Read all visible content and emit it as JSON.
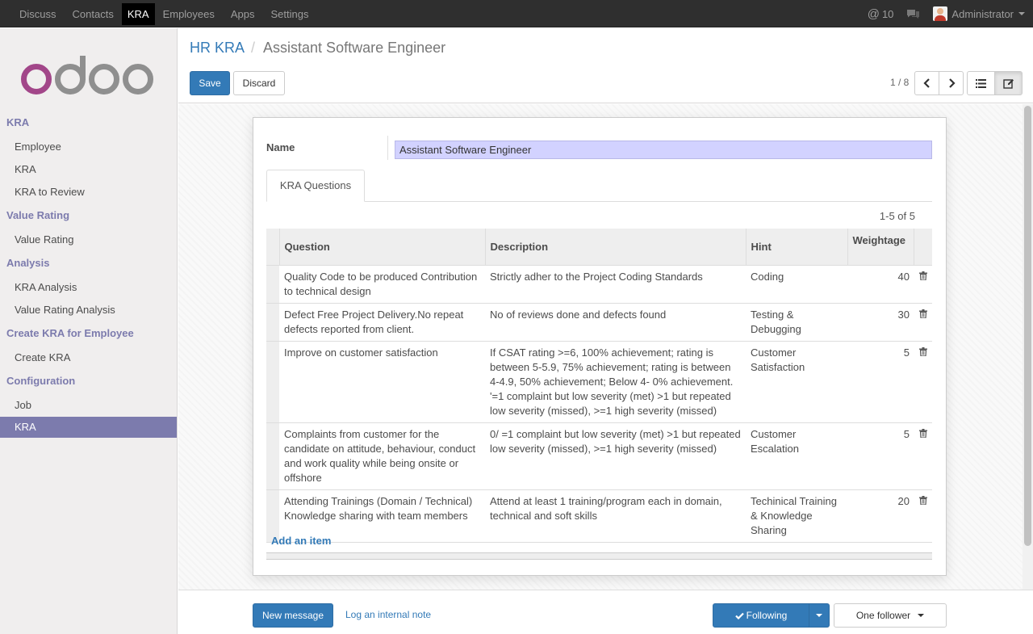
{
  "topnav": {
    "items": [
      {
        "label": "Discuss"
      },
      {
        "label": "Contacts"
      },
      {
        "label": "KRA"
      },
      {
        "label": "Employees"
      },
      {
        "label": "Apps"
      },
      {
        "label": "Settings"
      }
    ],
    "mentions": "10",
    "user": "Administrator"
  },
  "sidebar": {
    "sections": [
      {
        "title": "KRA",
        "items": [
          "Employee",
          "KRA",
          "KRA to Review"
        ]
      },
      {
        "title": "Value Rating",
        "items": [
          "Value Rating"
        ]
      },
      {
        "title": "Analysis",
        "items": [
          "KRA Analysis",
          "Value Rating Analysis"
        ]
      },
      {
        "title": "Create KRA for Employee",
        "items": [
          "Create KRA"
        ]
      },
      {
        "title": "Configuration",
        "items": [
          "Job",
          "KRA"
        ]
      }
    ]
  },
  "breadcrumb": {
    "parent": "HR KRA",
    "current": "Assistant Software Engineer"
  },
  "actions": {
    "save": "Save",
    "discard": "Discard"
  },
  "pager": {
    "value": "1 / 8"
  },
  "form": {
    "name_label": "Name",
    "name_value": "Assistant Software Engineer",
    "tab_label": "KRA Questions",
    "count": "1-5 of 5",
    "columns": {
      "question": "Question",
      "description": "Description",
      "hint": "Hint",
      "weightage": "Weightage"
    },
    "rows": [
      {
        "question": "Quality Code to be produced Contribution to technical design",
        "description": "Strictly adher to the Project Coding Standards",
        "hint": "Coding",
        "weightage": "40"
      },
      {
        "question": "Defect Free Project Delivery.No repeat defects reported from client.",
        "description": "No of reviews done and defects found",
        "hint": "Testing & Debugging",
        "weightage": "30"
      },
      {
        "question": "Improve on customer satisfaction",
        "description": "If CSAT rating >=6, 100% achievement; rating is between 5-5.9, 75% achievement; rating is between 4-4.9, 50% achievement; Below 4- 0% achievement. '=1 complaint but low severity (met) >1 but repeated low severity (missed), >=1 high severity (missed)",
        "hint": "Customer Satisfaction",
        "weightage": "5"
      },
      {
        "question": "Complaints from customer for the candidate on attitude, behaviour, conduct and work quality while being onsite or offshore",
        "description": "0/ =1 complaint but low severity (met) >1 but repeated low severity (missed), >=1 high severity (missed)",
        "hint": "Customer Escalation",
        "weightage": "5"
      },
      {
        "question": "Attending Trainings (Domain / Technical) Knowledge sharing with team members",
        "description": "Attend at least 1 training/program each in domain, technical and soft skills",
        "hint": "Techinical Training & Knowledge Sharing",
        "weightage": "20"
      }
    ],
    "add_item": "Add an item"
  },
  "chatter": {
    "new_message": "New message",
    "log_note": "Log an internal note",
    "following": "Following",
    "followers": "One follower"
  },
  "icons": {
    "mention": "at-icon",
    "chat": "chat-icon",
    "prev": "chevron-left-icon",
    "next": "chevron-right-icon",
    "list_view": "list-view-icon",
    "form_view": "form-edit-icon",
    "delete": "trash-icon",
    "check": "check-icon"
  },
  "colors": {
    "brand": "#7c7bad",
    "primary": "#337ab7",
    "topbar": "#2f2f2f",
    "input_highlight": "#d2d2ff"
  }
}
